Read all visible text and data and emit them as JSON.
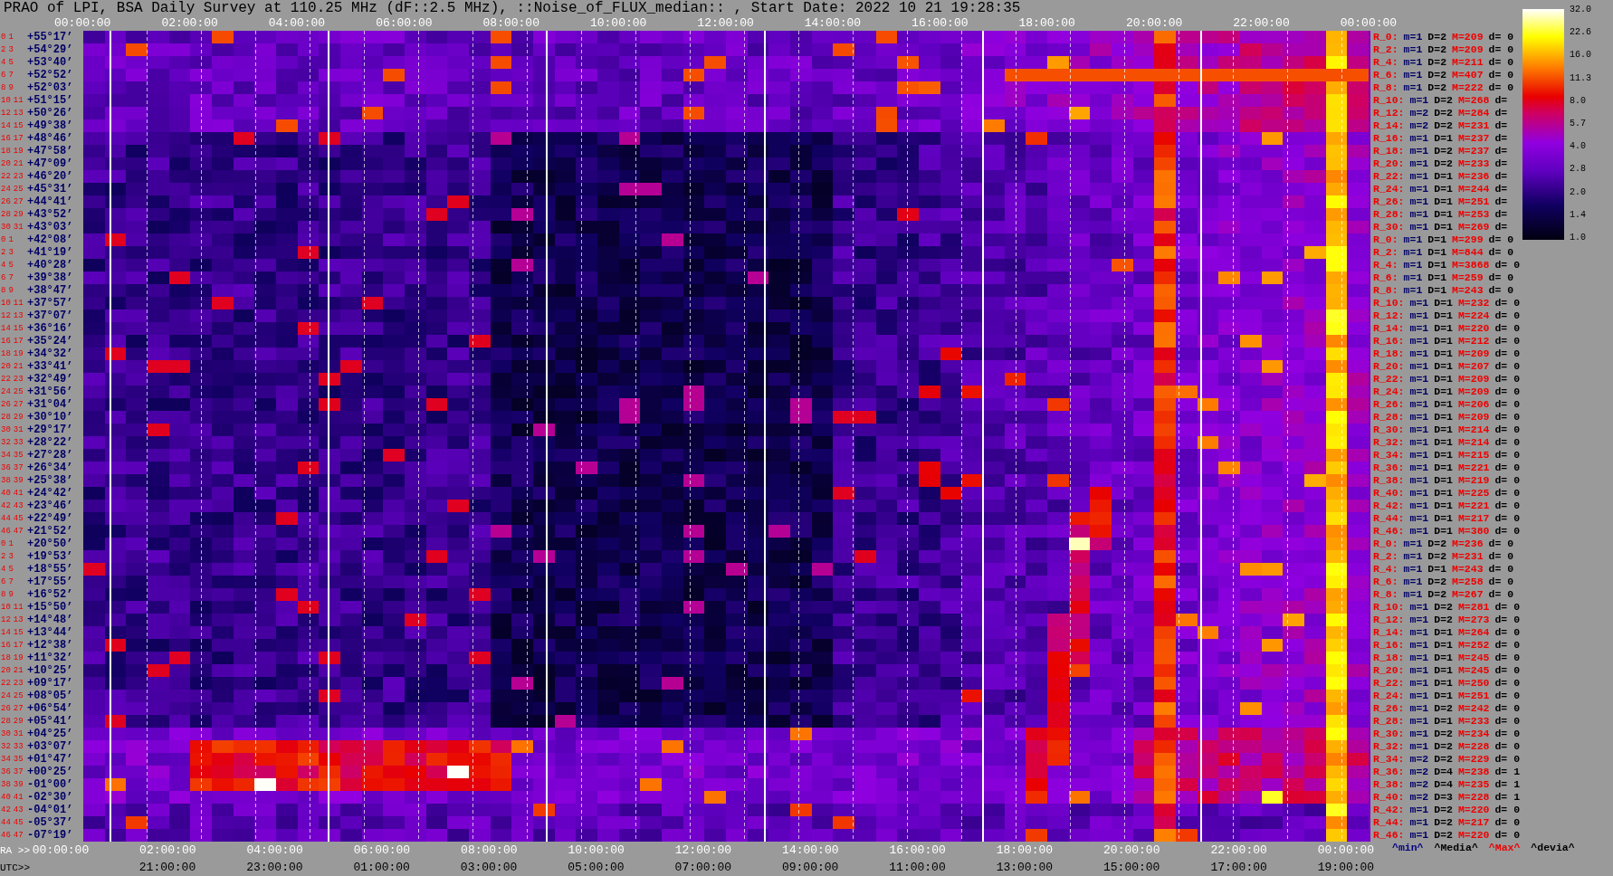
{
  "title": "PRAO of LPI, BSA Daily Survey at 110.25 MHz (dF::2.5 MHz), ::Noise_of_FLUX_median:: , Start Date: 2022 10 21 19:28:35",
  "top_axis": [
    "00:00:00",
    "02:00:00",
    "04:00:00",
    "06:00:00",
    "08:00:00",
    "10:00:00",
    "12:00:00",
    "14:00:00",
    "16:00:00",
    "18:00:00",
    "20:00:00",
    "22:00:00",
    "00:00:00"
  ],
  "rows": [
    {
      "indices": [
        "0",
        "1"
      ],
      "dec": "+55°17’"
    },
    {
      "indices": [
        "2",
        "3"
      ],
      "dec": "+54°29’"
    },
    {
      "indices": [
        "4",
        "5"
      ],
      "dec": "+53°40’"
    },
    {
      "indices": [
        "6",
        "7"
      ],
      "dec": "+52°52’"
    },
    {
      "indices": [
        "8",
        "9"
      ],
      "dec": "+52°03’"
    },
    {
      "indices": [
        "10",
        "11"
      ],
      "dec": "+51°15’"
    },
    {
      "indices": [
        "12",
        "13"
      ],
      "dec": "+50°26’"
    },
    {
      "indices": [
        "14",
        "15"
      ],
      "dec": "+49°38’"
    },
    {
      "indices": [
        "16",
        "17"
      ],
      "dec": "+48°46’"
    },
    {
      "indices": [
        "18",
        "19"
      ],
      "dec": "+47°58’"
    },
    {
      "indices": [
        "20",
        "21"
      ],
      "dec": "+47°09’"
    },
    {
      "indices": [
        "22",
        "23"
      ],
      "dec": "+46°20’"
    },
    {
      "indices": [
        "24",
        "25"
      ],
      "dec": "+45°31’"
    },
    {
      "indices": [
        "26",
        "27"
      ],
      "dec": "+44°41’"
    },
    {
      "indices": [
        "28",
        "29"
      ],
      "dec": "+43°52’"
    },
    {
      "indices": [
        "30",
        "31"
      ],
      "dec": "+43°03’"
    },
    {
      "indices": [
        "0",
        "1"
      ],
      "dec": "+42°08’"
    },
    {
      "indices": [
        "2",
        "3"
      ],
      "dec": "+41°19’"
    },
    {
      "indices": [
        "4",
        "5"
      ],
      "dec": "+40°28’"
    },
    {
      "indices": [
        "6",
        "7"
      ],
      "dec": "+39°38’"
    },
    {
      "indices": [
        "8",
        "9"
      ],
      "dec": "+38°47’"
    },
    {
      "indices": [
        "10",
        "11"
      ],
      "dec": "+37°57’"
    },
    {
      "indices": [
        "12",
        "13"
      ],
      "dec": "+37°07’"
    },
    {
      "indices": [
        "14",
        "15"
      ],
      "dec": "+36°16’"
    },
    {
      "indices": [
        "16",
        "17"
      ],
      "dec": "+35°24’"
    },
    {
      "indices": [
        "18",
        "19"
      ],
      "dec": "+34°32’"
    },
    {
      "indices": [
        "20",
        "21"
      ],
      "dec": "+33°41’"
    },
    {
      "indices": [
        "22",
        "23"
      ],
      "dec": "+32°49’"
    },
    {
      "indices": [
        "24",
        "25"
      ],
      "dec": "+31°56’"
    },
    {
      "indices": [
        "26",
        "27"
      ],
      "dec": "+31°04’"
    },
    {
      "indices": [
        "28",
        "29"
      ],
      "dec": "+30°10’"
    },
    {
      "indices": [
        "30",
        "31"
      ],
      "dec": "+29°17’"
    },
    {
      "indices": [
        "32",
        "33"
      ],
      "dec": "+28°22’"
    },
    {
      "indices": [
        "34",
        "35"
      ],
      "dec": "+27°28’"
    },
    {
      "indices": [
        "36",
        "37"
      ],
      "dec": "+26°34’"
    },
    {
      "indices": [
        "38",
        "39"
      ],
      "dec": "+25°38’"
    },
    {
      "indices": [
        "40",
        "41"
      ],
      "dec": "+24°42’"
    },
    {
      "indices": [
        "42",
        "43"
      ],
      "dec": "+23°46’"
    },
    {
      "indices": [
        "44",
        "45"
      ],
      "dec": "+22°49’"
    },
    {
      "indices": [
        "46",
        "47"
      ],
      "dec": "+21°52’"
    },
    {
      "indices": [
        "0",
        "1"
      ],
      "dec": "+20°50’"
    },
    {
      "indices": [
        "2",
        "3"
      ],
      "dec": "+19°53’"
    },
    {
      "indices": [
        "4",
        "5"
      ],
      "dec": "+18°55’"
    },
    {
      "indices": [
        "6",
        "7"
      ],
      "dec": "+17°55’"
    },
    {
      "indices": [
        "8",
        "9"
      ],
      "dec": "+16°52’"
    },
    {
      "indices": [
        "10",
        "11"
      ],
      "dec": "+15°50’"
    },
    {
      "indices": [
        "12",
        "13"
      ],
      "dec": "+14°48’"
    },
    {
      "indices": [
        "14",
        "15"
      ],
      "dec": "+13°44’"
    },
    {
      "indices": [
        "16",
        "17"
      ],
      "dec": "+12°38’"
    },
    {
      "indices": [
        "18",
        "19"
      ],
      "dec": "+11°32’"
    },
    {
      "indices": [
        "20",
        "21"
      ],
      "dec": "+10°25’"
    },
    {
      "indices": [
        "22",
        "23"
      ],
      "dec": "+09°17’"
    },
    {
      "indices": [
        "24",
        "25"
      ],
      "dec": "+08°05’"
    },
    {
      "indices": [
        "26",
        "27"
      ],
      "dec": "+06°54’"
    },
    {
      "indices": [
        "28",
        "29"
      ],
      "dec": "+05°41’"
    },
    {
      "indices": [
        "30",
        "31"
      ],
      "dec": "+04°25’"
    },
    {
      "indices": [
        "32",
        "33"
      ],
      "dec": "+03°07’"
    },
    {
      "indices": [
        "34",
        "35"
      ],
      "dec": "+01°47’"
    },
    {
      "indices": [
        "36",
        "37"
      ],
      "dec": "+00°25’"
    },
    {
      "indices": [
        "38",
        "39"
      ],
      "dec": "-01°00’"
    },
    {
      "indices": [
        "40",
        "41"
      ],
      "dec": "-02°30’"
    },
    {
      "indices": [
        "42",
        "43"
      ],
      "dec": "-04°01’"
    },
    {
      "indices": [
        "44",
        "45"
      ],
      "dec": "-05°37’"
    },
    {
      "indices": [
        "46",
        "47"
      ],
      "dec": "-07°19’"
    }
  ],
  "stats": [
    {
      "beam": "R_0:",
      "m": "m=1",
      "D": "D=2",
      "M": "M=209",
      "d": "d= 0"
    },
    {
      "beam": "R_2:",
      "m": "m=1",
      "D": "D=2",
      "M": "M=209",
      "d": "d= 0"
    },
    {
      "beam": "R_4:",
      "m": "m=1",
      "D": "D=2",
      "M": "M=211",
      "d": "d= 0"
    },
    {
      "beam": "R_6:",
      "m": "m=1",
      "D": "D=2",
      "M": "M=407",
      "d": "d= 0"
    },
    {
      "beam": "R_8:",
      "m": "m=1",
      "D": "D=2",
      "M": "M=222",
      "d": "d= 0"
    },
    {
      "beam": "R_10:",
      "m": "m=1",
      "D": "D=2",
      "M": "M=268",
      "d": "d="
    },
    {
      "beam": "R_12:",
      "m": "m=2",
      "D": "D=2",
      "M": "M=284",
      "d": "d="
    },
    {
      "beam": "R_14:",
      "m": "m=2",
      "D": "D=2",
      "M": "M=231",
      "d": "d="
    },
    {
      "beam": "R_16:",
      "m": "m=1",
      "D": "D=1",
      "M": "M=237",
      "d": "d="
    },
    {
      "beam": "R_18:",
      "m": "m=1",
      "D": "D=2",
      "M": "M=237",
      "d": "d="
    },
    {
      "beam": "R_20:",
      "m": "m=1",
      "D": "D=2",
      "M": "M=233",
      "d": "d="
    },
    {
      "beam": "R_22:",
      "m": "m=1",
      "D": "D=1",
      "M": "M=236",
      "d": "d="
    },
    {
      "beam": "R_24:",
      "m": "m=1",
      "D": "D=1",
      "M": "M=244",
      "d": "d="
    },
    {
      "beam": "R_26:",
      "m": "m=1",
      "D": "D=1",
      "M": "M=251",
      "d": "d="
    },
    {
      "beam": "R_28:",
      "m": "m=1",
      "D": "D=1",
      "M": "M=253",
      "d": "d="
    },
    {
      "beam": "R_30:",
      "m": "m=1",
      "D": "D=1",
      "M": "M=269",
      "d": "d="
    },
    {
      "beam": "R_0:",
      "m": "m=1",
      "D": "D=1",
      "M": "M=299",
      "d": "d= 0"
    },
    {
      "beam": "R_2:",
      "m": "m=1",
      "D": "D=1",
      "M": "M=844",
      "d": "d= 0"
    },
    {
      "beam": "R_4:",
      "m": "m=1",
      "D": "D=1",
      "M": "M=3868",
      "d": "d= 0"
    },
    {
      "beam": "R_6:",
      "m": "m=1",
      "D": "D=1",
      "M": "M=259",
      "d": "d= 0"
    },
    {
      "beam": "R_8:",
      "m": "m=1",
      "D": "D=1",
      "M": "M=243",
      "d": "d= 0"
    },
    {
      "beam": "R_10:",
      "m": "m=1",
      "D": "D=1",
      "M": "M=232",
      "d": "d= 0"
    },
    {
      "beam": "R_12:",
      "m": "m=1",
      "D": "D=1",
      "M": "M=224",
      "d": "d= 0"
    },
    {
      "beam": "R_14:",
      "m": "m=1",
      "D": "D=1",
      "M": "M=220",
      "d": "d= 0"
    },
    {
      "beam": "R_16:",
      "m": "m=1",
      "D": "D=1",
      "M": "M=212",
      "d": "d= 0"
    },
    {
      "beam": "R_18:",
      "m": "m=1",
      "D": "D=1",
      "M": "M=209",
      "d": "d= 0"
    },
    {
      "beam": "R_20:",
      "m": "m=1",
      "D": "D=1",
      "M": "M=207",
      "d": "d= 0"
    },
    {
      "beam": "R_22:",
      "m": "m=1",
      "D": "D=1",
      "M": "M=209",
      "d": "d= 0"
    },
    {
      "beam": "R_24:",
      "m": "m=1",
      "D": "D=1",
      "M": "M=209",
      "d": "d= 0"
    },
    {
      "beam": "R_26:",
      "m": "m=1",
      "D": "D=1",
      "M": "M=206",
      "d": "d= 0"
    },
    {
      "beam": "R_28:",
      "m": "m=1",
      "D": "D=1",
      "M": "M=209",
      "d": "d= 0"
    },
    {
      "beam": "R_30:",
      "m": "m=1",
      "D": "D=1",
      "M": "M=214",
      "d": "d= 0"
    },
    {
      "beam": "R_32:",
      "m": "m=1",
      "D": "D=1",
      "M": "M=214",
      "d": "d= 0"
    },
    {
      "beam": "R_34:",
      "m": "m=1",
      "D": "D=1",
      "M": "M=215",
      "d": "d= 0"
    },
    {
      "beam": "R_36:",
      "m": "m=1",
      "D": "D=1",
      "M": "M=221",
      "d": "d= 0"
    },
    {
      "beam": "R_38:",
      "m": "m=1",
      "D": "D=1",
      "M": "M=219",
      "d": "d= 0"
    },
    {
      "beam": "R_40:",
      "m": "m=1",
      "D": "D=1",
      "M": "M=225",
      "d": "d= 0"
    },
    {
      "beam": "R_42:",
      "m": "m=1",
      "D": "D=1",
      "M": "M=221",
      "d": "d= 0"
    },
    {
      "beam": "R_44:",
      "m": "m=1",
      "D": "D=1",
      "M": "M=217",
      "d": "d= 0"
    },
    {
      "beam": "R_46:",
      "m": "m=1",
      "D": "D=1",
      "M": "M=380",
      "d": "d= 0"
    },
    {
      "beam": "R_0:",
      "m": "m=1",
      "D": "D=2",
      "M": "M=236",
      "d": "d= 0"
    },
    {
      "beam": "R_2:",
      "m": "m=1",
      "D": "D=2",
      "M": "M=231",
      "d": "d= 0"
    },
    {
      "beam": "R_4:",
      "m": "m=1",
      "D": "D=1",
      "M": "M=243",
      "d": "d= 0"
    },
    {
      "beam": "R_6:",
      "m": "m=1",
      "D": "D=2",
      "M": "M=258",
      "d": "d= 0"
    },
    {
      "beam": "R_8:",
      "m": "m=1",
      "D": "D=2",
      "M": "M=267",
      "d": "d= 0"
    },
    {
      "beam": "R_10:",
      "m": "m=1",
      "D": "D=2",
      "M": "M=281",
      "d": "d= 0"
    },
    {
      "beam": "R_12:",
      "m": "m=1",
      "D": "D=2",
      "M": "M=273",
      "d": "d= 0"
    },
    {
      "beam": "R_14:",
      "m": "m=1",
      "D": "D=1",
      "M": "M=264",
      "d": "d= 0"
    },
    {
      "beam": "R_16:",
      "m": "m=1",
      "D": "D=1",
      "M": "M=252",
      "d": "d= 0"
    },
    {
      "beam": "R_18:",
      "m": "m=1",
      "D": "D=1",
      "M": "M=245",
      "d": "d= 0"
    },
    {
      "beam": "R_20:",
      "m": "m=1",
      "D": "D=1",
      "M": "M=245",
      "d": "d= 0"
    },
    {
      "beam": "R_22:",
      "m": "m=1",
      "D": "D=1",
      "M": "M=250",
      "d": "d= 0"
    },
    {
      "beam": "R_24:",
      "m": "m=1",
      "D": "D=1",
      "M": "M=251",
      "d": "d= 0"
    },
    {
      "beam": "R_26:",
      "m": "m=1",
      "D": "D=2",
      "M": "M=242",
      "d": "d= 0"
    },
    {
      "beam": "R_28:",
      "m": "m=1",
      "D": "D=1",
      "M": "M=233",
      "d": "d= 0"
    },
    {
      "beam": "R_30:",
      "m": "m=1",
      "D": "D=2",
      "M": "M=234",
      "d": "d= 0"
    },
    {
      "beam": "R_32:",
      "m": "m=1",
      "D": "D=2",
      "M": "M=228",
      "d": "d= 0"
    },
    {
      "beam": "R_34:",
      "m": "m=2",
      "D": "D=2",
      "M": "M=229",
      "d": "d= 0"
    },
    {
      "beam": "R_36:",
      "m": "m=2",
      "D": "D=4",
      "M": "M=238",
      "d": "d= 1"
    },
    {
      "beam": "R_38:",
      "m": "m=2",
      "D": "D=4",
      "M": "M=235",
      "d": "d= 1"
    },
    {
      "beam": "R_40:",
      "m": "m=2",
      "D": "D=3",
      "M": "M=228",
      "d": "d= 1"
    },
    {
      "beam": "R_42:",
      "m": "m=1",
      "D": "D=2",
      "M": "M=220",
      "d": "d= 0"
    },
    {
      "beam": "R_44:",
      "m": "m=1",
      "D": "D=2",
      "M": "M=217",
      "d": "d= 0"
    },
    {
      "beam": "R_46:",
      "m": "m=1",
      "D": "D=2",
      "M": "M=220",
      "d": "d= 0"
    }
  ],
  "legend": [
    {
      "kind": "min",
      "text": "^min^"
    },
    {
      "kind": "median",
      "text": "^Media^"
    },
    {
      "kind": "max",
      "text": "^Max^"
    },
    {
      "kind": "deviation",
      "text": "^devia^"
    }
  ],
  "colorbar": {
    "ticks": [
      "32.0",
      "22.6",
      "16.0",
      "11.3",
      "8.0",
      "5.7",
      "4.0",
      "2.8",
      "2.0",
      "1.4",
      "1.0"
    ]
  },
  "ra_axis": {
    "label": "RA >>",
    "ticks": [
      "00:00:00",
      "02:00:00",
      "04:00:00",
      "06:00:00",
      "08:00:00",
      "10:00:00",
      "12:00:00",
      "14:00:00",
      "16:00:00",
      "18:00:00",
      "20:00:00",
      "22:00:00",
      "00:00:00"
    ]
  },
  "utc_axis": {
    "label": "UTC>>",
    "ticks": [
      "21:00:00",
      "23:00:00",
      "01:00:00",
      "03:00:00",
      "05:00:00",
      "07:00:00",
      "09:00:00",
      "11:00:00",
      "13:00:00",
      "15:00:00",
      "17:00:00",
      "19:00:00"
    ]
  }
}
